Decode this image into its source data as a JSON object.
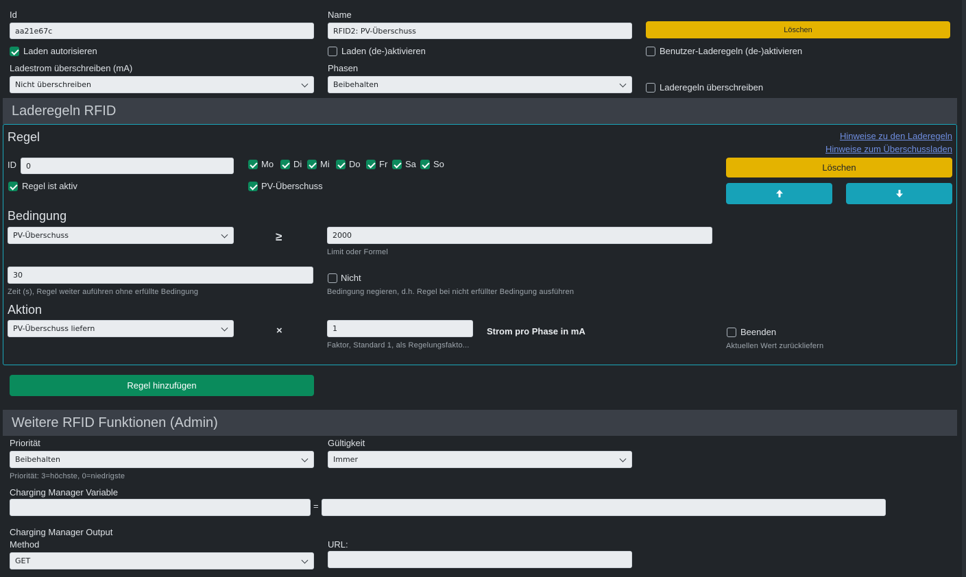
{
  "top": {
    "id_label": "Id",
    "id_value": "aa21e67c",
    "name_label": "Name",
    "name_value": "RFID2: PV-Überschuss",
    "delete_label": "Löschen",
    "authorize_label": "Laden autorisieren",
    "authorize_checked": true,
    "activate_label": "Laden (de-)aktivieren",
    "activate_checked": false,
    "user_rules_label": "Benutzer-Laderegeln (de-)aktivieren",
    "user_rules_checked": false,
    "current_label": "Ladestrom überschreiben (mA)",
    "current_value": "Nicht überschreiben",
    "phases_label": "Phasen",
    "phases_value": "Beibehalten",
    "override_rules_label": "Laderegeln überschreiben",
    "override_rules_checked": false
  },
  "rules_section": {
    "title": "Laderegeln RFID",
    "rule_heading": "Regel",
    "hint_rules_link": "Hinweise zu den Laderegeln",
    "hint_surplus_link": "Hinweise zum Überschussladen",
    "id_label": "ID",
    "id_value": "0",
    "days": [
      {
        "label": "Mo",
        "checked": true
      },
      {
        "label": "Di",
        "checked": true
      },
      {
        "label": "Mi",
        "checked": true
      },
      {
        "label": "Do",
        "checked": true
      },
      {
        "label": "Fr",
        "checked": true
      },
      {
        "label": "Sa",
        "checked": true
      },
      {
        "label": "So",
        "checked": true
      }
    ],
    "active_label": "Regel ist aktiv",
    "pv_label": "PV-Überschuss",
    "delete_label": "Löschen",
    "up_icon": "arrow-up-icon",
    "down_icon": "arrow-down-icon",
    "condition_heading": "Bedingung",
    "condition_value": "PV-Überschuss",
    "operator": "≥",
    "limit_value": "2000",
    "limit_hint": "Limit oder Formel",
    "time_value": "30",
    "time_hint": "Zeit (s), Regel weiter auführen ohne erfüllte Bedingung",
    "not_label": "Nicht",
    "not_hint": "Bedingung negieren, d.h. Regel bei nicht erfüllter Bedingung ausführen",
    "action_heading": "Aktion",
    "action_value": "PV-Überschuss liefern",
    "multiply": "×",
    "factor_value": "1",
    "factor_hint": "Faktor, Standard 1, als Regelungsfakto...",
    "unit_label": "Strom pro Phase in mA",
    "end_label": "Beenden",
    "end_hint": "Aktuellen Wert zurückliefern",
    "add_rule_label": "Regel hinzufügen"
  },
  "admin_section": {
    "title": "Weitere RFID Funktionen (Admin)",
    "priority_label": "Priorität",
    "priority_value": "Beibehalten",
    "priority_hint": "Priorität: 3=höchste, 0=niedrigste",
    "validity_label": "Gültigkeit",
    "validity_value": "Immer",
    "cm_variable_label": "Charging Manager Variable",
    "cm_variable_value": "",
    "equals": "=",
    "cm_variable_expr": "",
    "cm_output_label": "Charging Manager Output",
    "method_label": "Method",
    "method_value": "GET",
    "url_label": "URL:",
    "url_value": ""
  }
}
